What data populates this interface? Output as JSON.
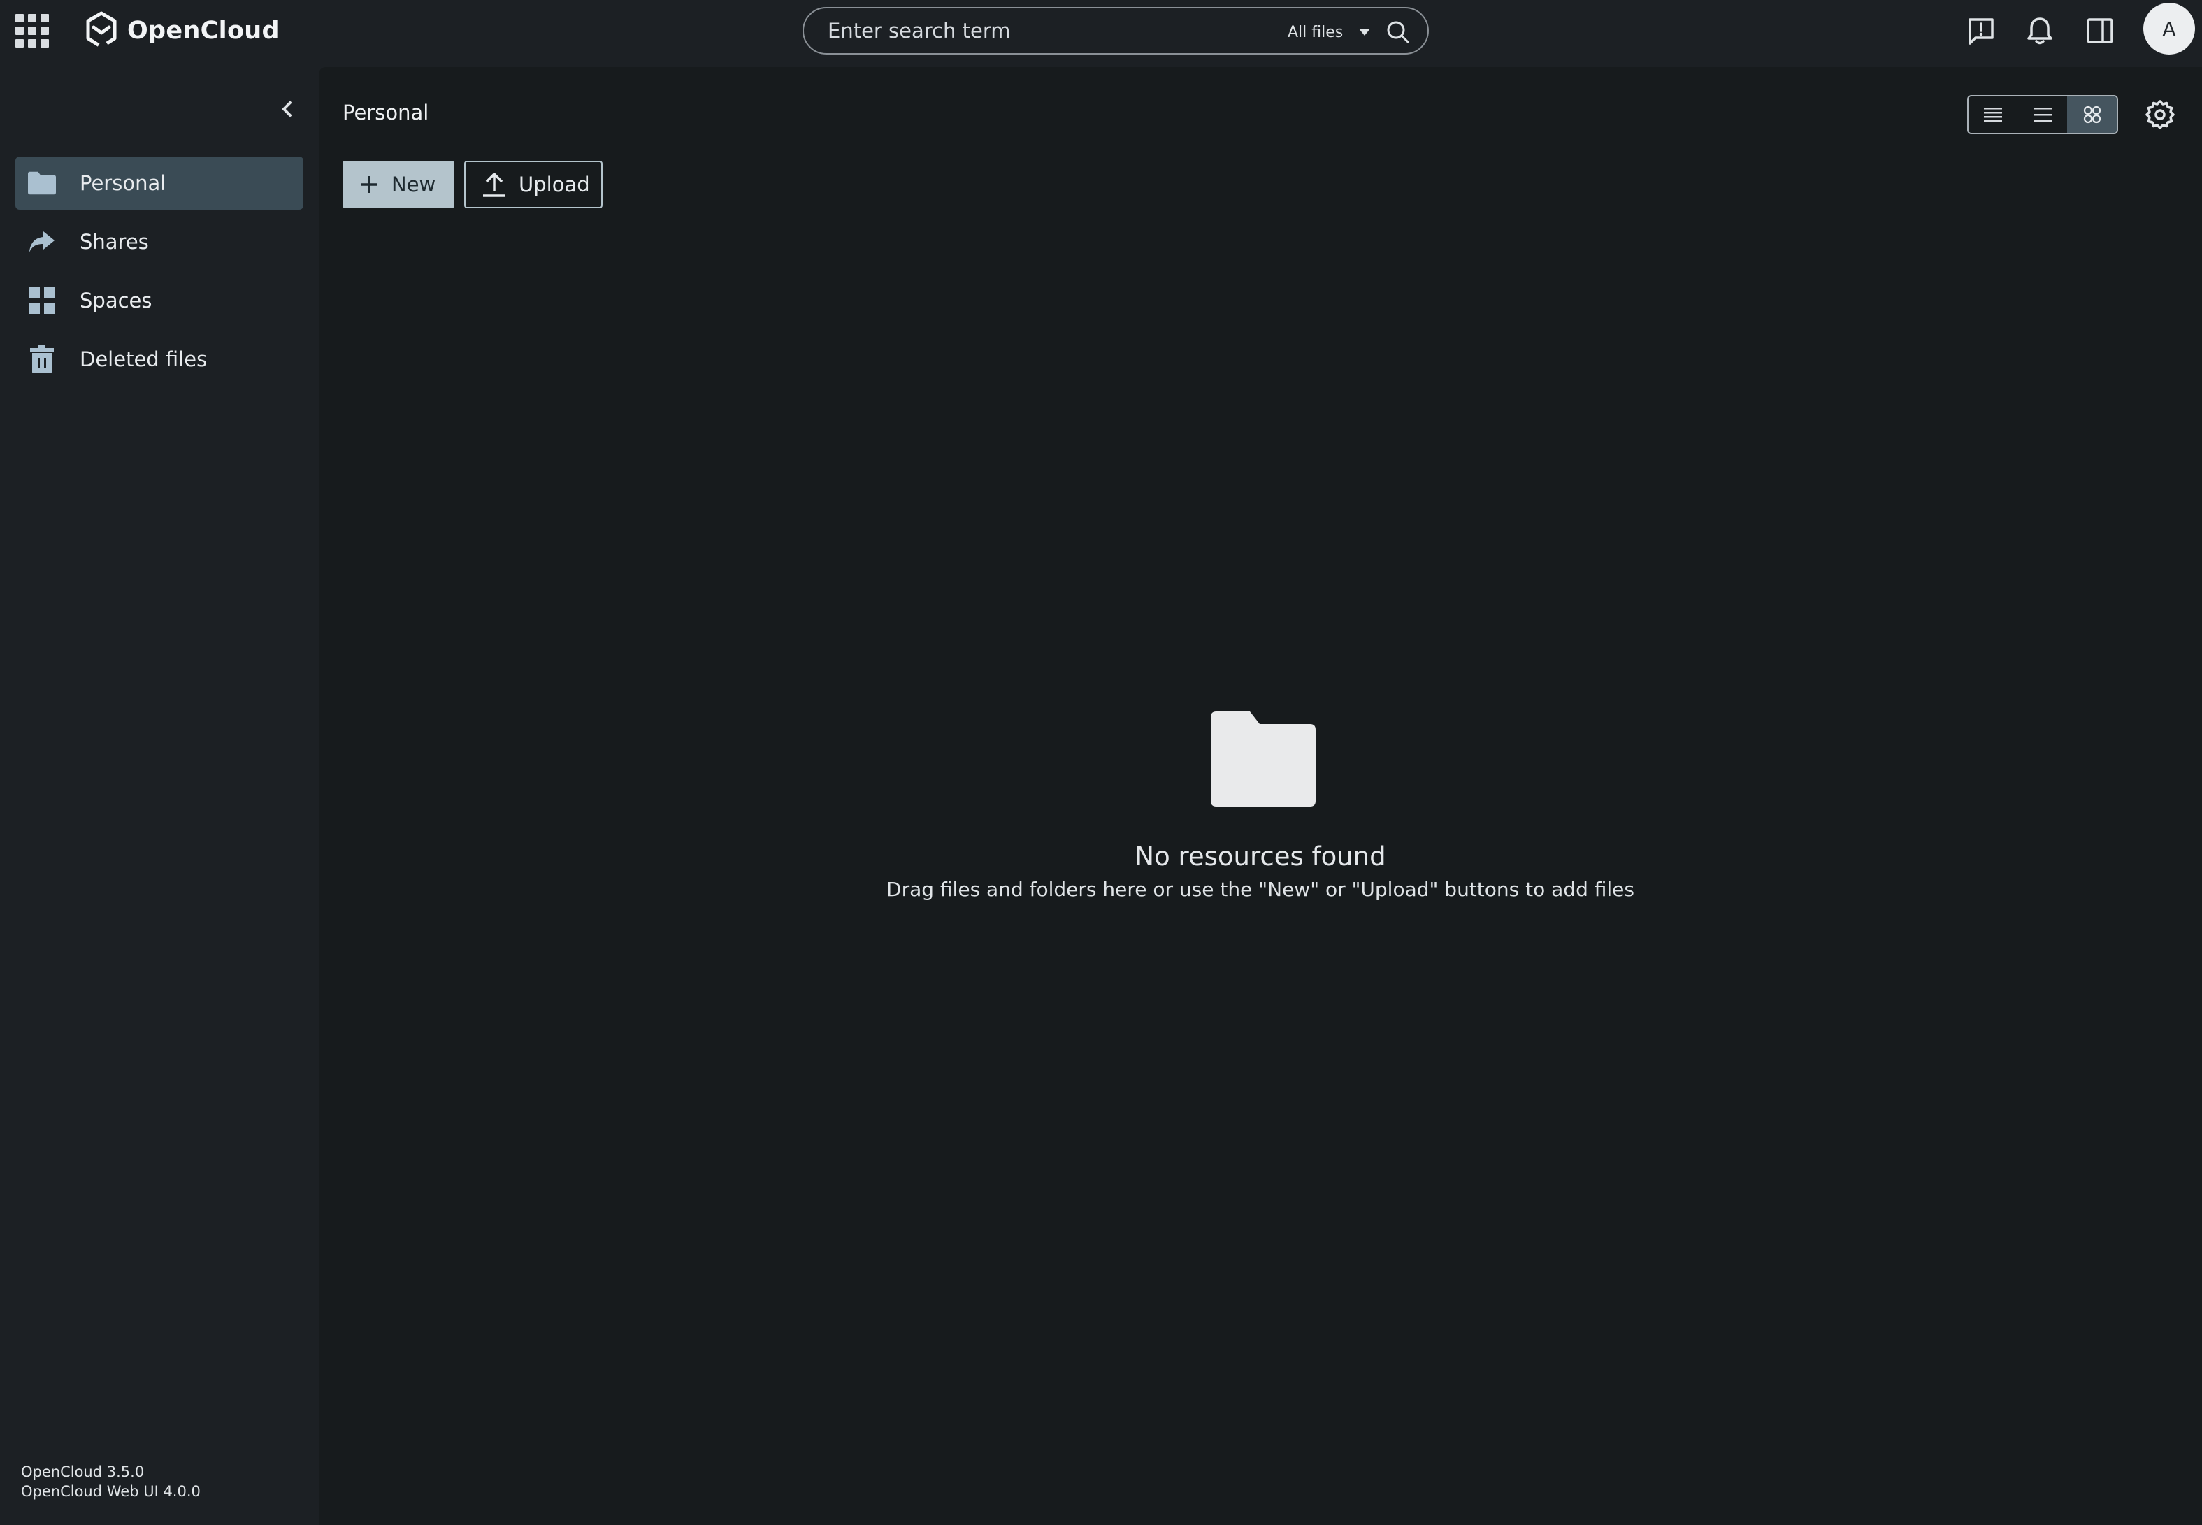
{
  "app": {
    "name": "OpenCloud"
  },
  "search": {
    "placeholder": "Enter search term",
    "scope": "All files"
  },
  "user": {
    "avatar_initial": "A"
  },
  "sidebar": {
    "items": [
      {
        "label": "Personal",
        "icon": "folder-icon",
        "active": true
      },
      {
        "label": "Shares",
        "icon": "share-arrow-icon",
        "active": false
      },
      {
        "label": "Spaces",
        "icon": "grid-icon",
        "active": false
      },
      {
        "label": "Deleted files",
        "icon": "trash-icon",
        "active": false
      }
    ],
    "versions": [
      "OpenCloud 3.5.0",
      "OpenCloud Web UI 4.0.0"
    ]
  },
  "main": {
    "breadcrumb": "Personal",
    "actions": {
      "new_label": "New",
      "upload_label": "Upload"
    },
    "view_modes": [
      "condensed-table",
      "table",
      "tiles"
    ],
    "active_view": "tiles",
    "empty": {
      "title": "No resources found",
      "message": "Drag files and folders here or use the \"New\" or \"Upload\" buttons to add files"
    }
  },
  "colors": {
    "background": "#1c2024",
    "main_background": "#171b1d",
    "active_nav": "#3a4b55",
    "primary_button": "#b4c4cc"
  }
}
